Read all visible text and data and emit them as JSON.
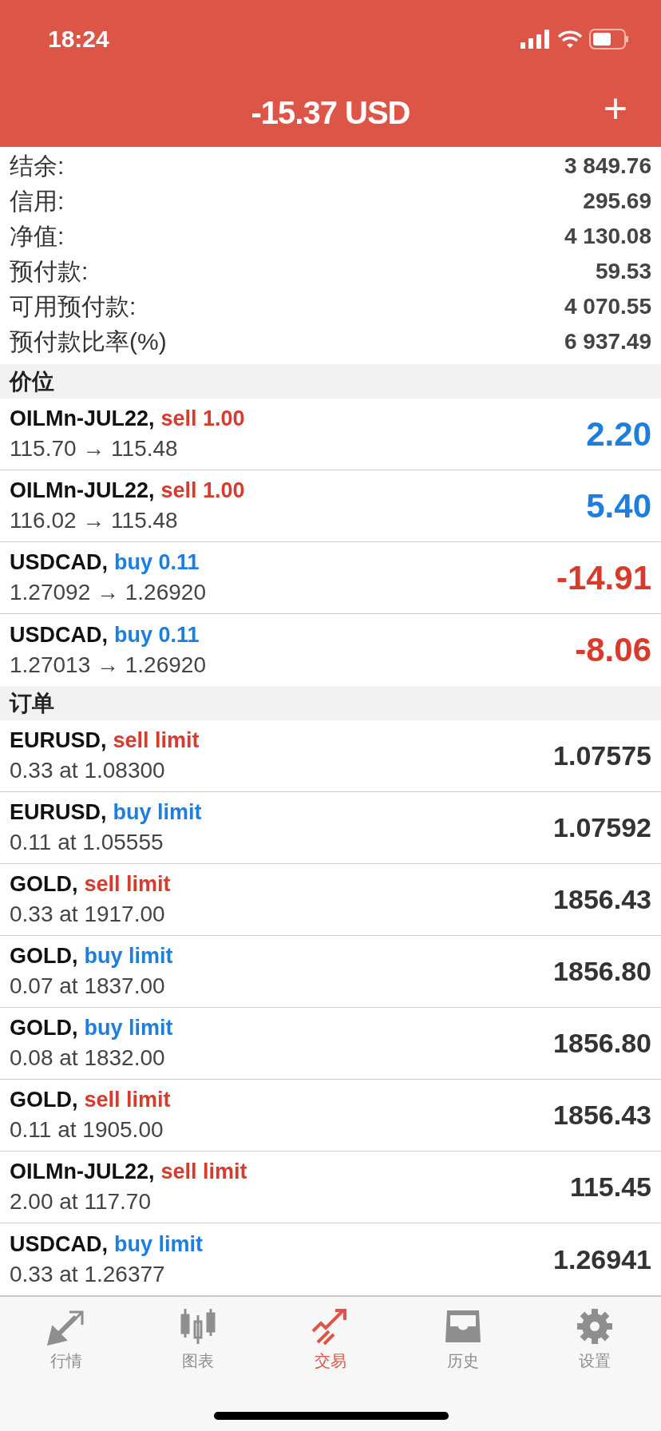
{
  "status_bar": {
    "time": "18:24"
  },
  "header": {
    "title": "-15.37 USD",
    "action": "+"
  },
  "summary": [
    {
      "label": "结余:",
      "value": "3 849.76"
    },
    {
      "label": "信用:",
      "value": "295.69"
    },
    {
      "label": "净值:",
      "value": "4 130.08"
    },
    {
      "label": "预付款:",
      "value": "59.53"
    },
    {
      "label": "可用预付款:",
      "value": "4 070.55"
    },
    {
      "label": "预付款比率(%)",
      "value": "6 937.49"
    }
  ],
  "positions": {
    "title": "价位",
    "rows": [
      {
        "symbol": "OILMn-JUL22,",
        "kind": "sell",
        "action": "sell 1.00",
        "detail": "115.70 → 115.48",
        "value": "2.20",
        "color": "#1d7ee0"
      },
      {
        "symbol": "OILMn-JUL22,",
        "kind": "sell",
        "action": "sell 1.00",
        "detail": "116.02 → 115.48",
        "value": "5.40",
        "color": "#1d7ee0"
      },
      {
        "symbol": "USDCAD,",
        "kind": "buy",
        "action": "buy 0.11",
        "detail": "1.27092 → 1.26920",
        "value": "-14.91",
        "color": "#d83a2c"
      },
      {
        "symbol": "USDCAD,",
        "kind": "buy",
        "action": "buy 0.11",
        "detail": "1.27013 → 1.26920",
        "value": "-8.06",
        "color": "#d83a2c"
      }
    ]
  },
  "orders": {
    "title": "订单",
    "rows": [
      {
        "symbol": "EURUSD,",
        "kind": "sell",
        "action": "sell limit",
        "detail": "0.33 at 1.08300",
        "value": "1.07575"
      },
      {
        "symbol": "EURUSD,",
        "kind": "buy",
        "action": "buy limit",
        "detail": "0.11 at 1.05555",
        "value": "1.07592"
      },
      {
        "symbol": "GOLD,",
        "kind": "sell",
        "action": "sell limit",
        "detail": "0.33 at 1917.00",
        "value": "1856.43"
      },
      {
        "symbol": "GOLD,",
        "kind": "buy",
        "action": "buy limit",
        "detail": "0.07 at 1837.00",
        "value": "1856.80"
      },
      {
        "symbol": "GOLD,",
        "kind": "buy",
        "action": "buy limit",
        "detail": "0.08 at 1832.00",
        "value": "1856.80"
      },
      {
        "symbol": "GOLD,",
        "kind": "sell",
        "action": "sell limit",
        "detail": "0.11 at 1905.00",
        "value": "1856.43"
      },
      {
        "symbol": "OILMn-JUL22,",
        "kind": "sell",
        "action": "sell limit",
        "detail": "2.00 at 117.70",
        "value": "115.45"
      },
      {
        "symbol": "USDCAD,",
        "kind": "buy",
        "action": "buy limit",
        "detail": "0.33 at 1.26377",
        "value": "1.26941"
      }
    ]
  },
  "tabs": [
    {
      "kind": "quotes",
      "label": "行情",
      "selected": false
    },
    {
      "kind": "chart",
      "label": "图表",
      "selected": false
    },
    {
      "kind": "trade",
      "label": "交易",
      "selected": true
    },
    {
      "kind": "history",
      "label": "历史",
      "selected": false
    },
    {
      "kind": "settings",
      "label": "设置",
      "selected": false
    }
  ]
}
